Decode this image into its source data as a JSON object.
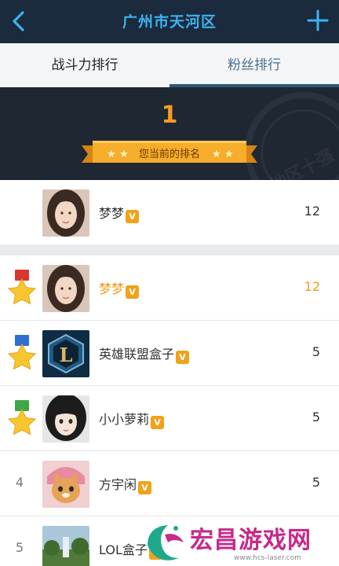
{
  "header": {
    "title": "广州市天河区",
    "back_icon": "chevron-left-icon",
    "add_icon": "plus-icon",
    "accent": "#3cb3ee",
    "background": "#1b2a3d"
  },
  "tabs": [
    {
      "label": "战斗力排行",
      "selected": false
    },
    {
      "label": "粉丝排行",
      "selected": true
    }
  ],
  "my_rank": {
    "rank": "1",
    "label": "您当前的排名",
    "user": {
      "name": "梦梦",
      "badge": "V",
      "score": "12"
    }
  },
  "ranking": [
    {
      "rank": "1",
      "medal": "gold-medal-icon",
      "name": "梦梦",
      "badge": "V",
      "score": "12",
      "highlight": true
    },
    {
      "rank": "2",
      "medal": "silver-medal-icon",
      "name": "英雄联盟盒子",
      "badge": "V",
      "score": "5",
      "highlight": false
    },
    {
      "rank": "3",
      "medal": "bronze-medal-icon",
      "name": "小小萝莉",
      "badge": "V",
      "score": "5",
      "highlight": false
    },
    {
      "rank": "4",
      "name": "方宇闲",
      "badge": "V",
      "score": "5",
      "highlight": false
    },
    {
      "rank": "5",
      "name": "LOL盒子",
      "badge": "V",
      "score": "",
      "highlight": false
    }
  ],
  "watermark": {
    "text": "宏昌游戏网",
    "url": "www.hcs-laser.com"
  },
  "colors": {
    "highlight": "#f19a19",
    "badge": "#f0a21a",
    "tab_active": "#2c5775"
  }
}
